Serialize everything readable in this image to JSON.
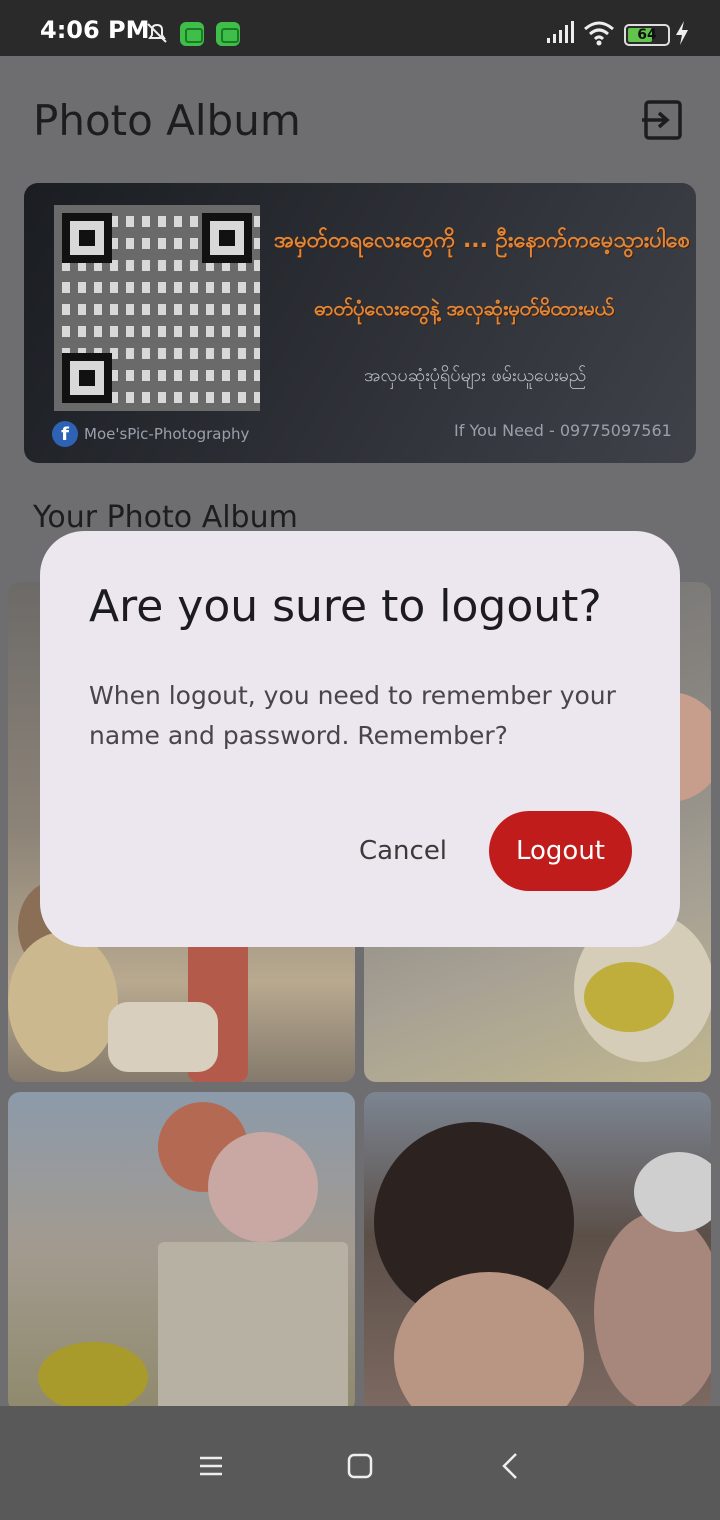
{
  "status_bar": {
    "time": "4:06 PM",
    "battery": "64",
    "battery_level": 0.64,
    "icons": [
      "mute-icon",
      "app-badge-icon",
      "app-badge-icon",
      "signal-icon",
      "wifi-icon",
      "battery-icon",
      "charging-bolt-icon"
    ]
  },
  "header": {
    "title": "Photo Album",
    "logout_icon": "exit-icon"
  },
  "banner": {
    "line1": "အမှတ်တရလေးတွေကို ... ဦးနောက်ကမေ့သွားပါစေ",
    "line2": "ဓာတ်ပုံလေးတွေနဲ့ အလှဆုံးမှတ်မိထားမယ်",
    "line3": "အလှပဆုံးပုံရိပ်များ ဖမ်းယူပေးမည်",
    "facebook_text": "Moe'sPic-Photography",
    "contact": "If You Need - 09775097561"
  },
  "section_title": "Your Photo Album",
  "dialog": {
    "title": "Are you sure to logout?",
    "message": "When logout, you need to remember your name and password. Remember?",
    "cancel_label": "Cancel",
    "logout_label": "Logout",
    "logout_color": "#c11c1c"
  },
  "nav_bar": {
    "icons": [
      "recents-icon",
      "home-icon",
      "back-icon"
    ]
  }
}
